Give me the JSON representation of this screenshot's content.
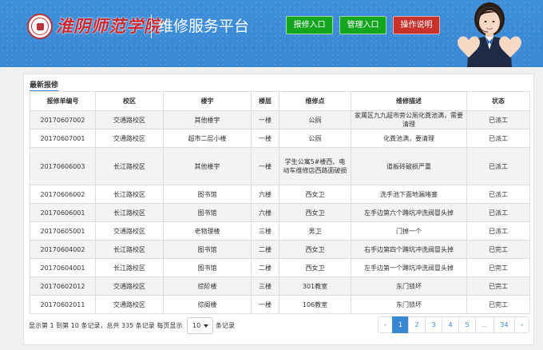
{
  "header": {
    "school_name": "淮阴师范学院",
    "platform_title": "维修服务平台",
    "buttons": {
      "repair": "报修入口",
      "admin": "管理入口",
      "help": "操作说明"
    },
    "colors": {
      "bar": "#3a87d4",
      "green_button": "#14a51f",
      "red_button": "#c9322b",
      "seal": "#b8343a"
    }
  },
  "panel": {
    "title": "最新报修",
    "columns": [
      "报修单编号",
      "校区",
      "楼宇",
      "楼层",
      "维修点",
      "维修描述",
      "状态"
    ],
    "rows": [
      [
        "20170607002",
        "交通路校区",
        "其他楼宇",
        "一楼",
        "公厕",
        "家属区九九超市旁公厕化粪池满，需要清理",
        "已派工"
      ],
      [
        "20170607001",
        "交通路校区",
        "超市二层小楼",
        "一楼",
        "公厕",
        "化粪池满，要清理",
        "已派工"
      ],
      [
        "20170606003",
        "长江路校区",
        "其他楼宇",
        "一楼",
        "学生公寓5#楼西、电动车维修店西路面破损",
        "道板砖破损严重",
        "已派工"
      ],
      [
        "20170606002",
        "长江路校区",
        "图书馆",
        "六楼",
        "西女卫",
        "洗手池下面地漏堵塞",
        "已派工"
      ],
      [
        "20170606001",
        "长江路校区",
        "图书馆",
        "六楼",
        "西女卫",
        "左手边第六个蹲坑冲洗阀冒头掉",
        "已派工"
      ],
      [
        "20170605001",
        "交通路校区",
        "老物理楼",
        "三楼",
        "男卫",
        "门掉一个",
        "已派工"
      ],
      [
        "20170604002",
        "长江路校区",
        "图书馆",
        "二楼",
        "西女卫",
        "右手边第四个蹲坑冲洗阀冒头掉",
        "已完工"
      ],
      [
        "20170604001",
        "长江路校区",
        "图书馆",
        "二楼",
        "西女卫",
        "左手边第一个蹲坑冲洗阀冒头掉",
        "已完工"
      ],
      [
        "20170602012",
        "交通路校区",
        "综阶楼",
        "三楼",
        "301教室",
        "东门锁坏",
        "已完工"
      ],
      [
        "20170602011",
        "交通路校区",
        "综阁楼",
        "一楼",
        "106教室",
        "东门锁坏",
        "已完工"
      ]
    ]
  },
  "footer": {
    "info_prefix": "显示第 1 到第 10 条记录，总共 335 条记录 每页显示",
    "page_size": "10",
    "info_suffix": "条记录"
  },
  "pagination": {
    "prev": "‹",
    "pages": [
      "1",
      "2",
      "3",
      "4",
      "5",
      "...",
      "34"
    ],
    "active_page": "1",
    "next": "›"
  }
}
